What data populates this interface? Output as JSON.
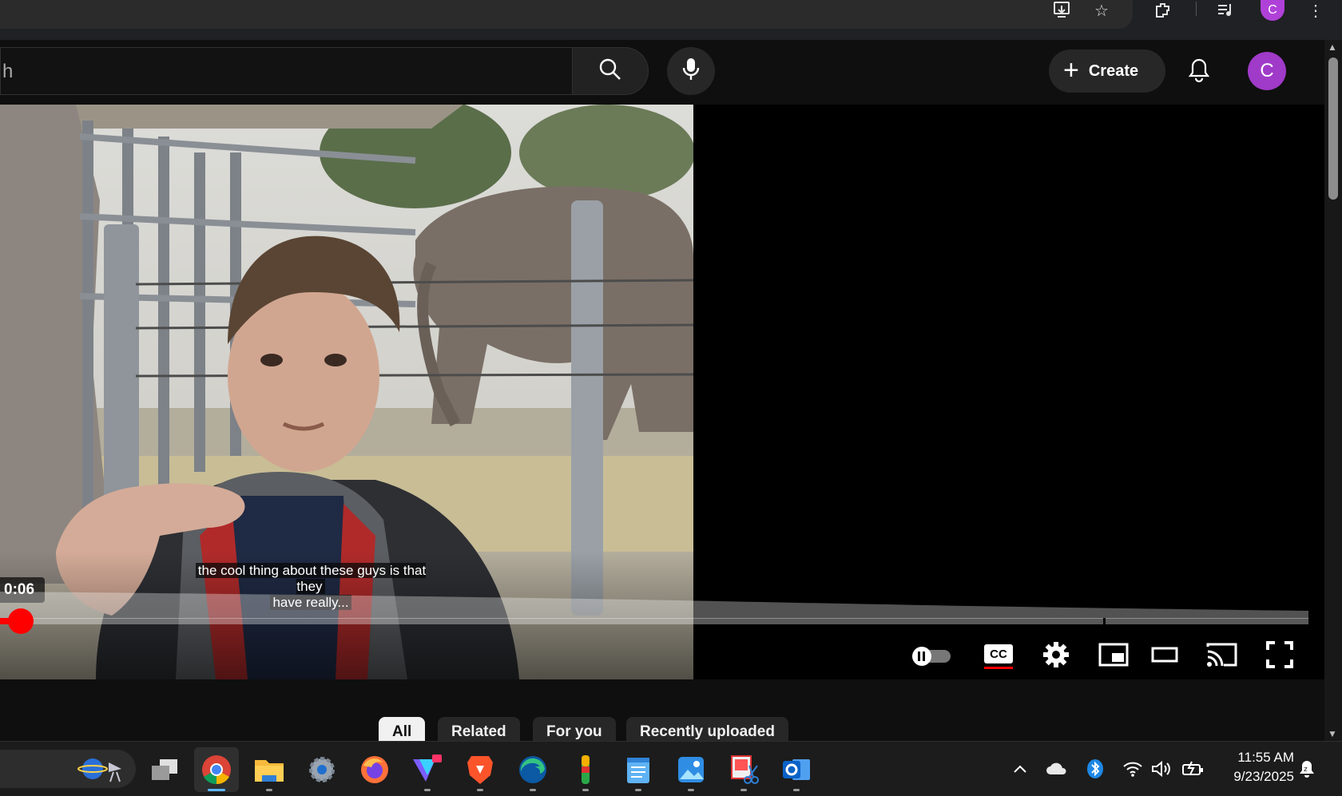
{
  "chrome": {
    "profile_initial": "C",
    "icons": [
      "install-app-icon",
      "bookmark-star-icon",
      "extensions-icon",
      "media-controls-icon",
      "profile-avatar",
      "menu-icon"
    ]
  },
  "header": {
    "search_text": "h",
    "create_label": "Create",
    "avatar_initial": "C",
    "icons": [
      "search-icon",
      "microphone-icon",
      "plus-icon",
      "bell-icon"
    ]
  },
  "player": {
    "caption_line1": "the cool thing about these guys is that they",
    "caption_line2": "have really...",
    "hover_time": "0:06",
    "progress_fraction": 0.016,
    "controls": [
      "autoplay-toggle",
      "captions-icon",
      "settings-gear-icon",
      "miniplayer-icon",
      "theater-mode-icon",
      "cast-icon",
      "fullscreen-icon"
    ],
    "cc_label": "CC"
  },
  "chips": [
    {
      "label": "All",
      "active": true
    },
    {
      "label": "Related",
      "active": false
    },
    {
      "label": "For you",
      "active": false
    },
    {
      "label": "Recently uploaded",
      "active": false
    }
  ],
  "taskbar": {
    "apps": [
      "search-box",
      "task-view-icon",
      "chrome-icon",
      "file-explorer-icon",
      "settings-icon",
      "firefox-icon",
      "vpn-icon",
      "brave-icon",
      "edge-icon",
      "onepassword-icon",
      "notepad-icon",
      "photos-icon",
      "snipping-tool-icon",
      "outlook-icon"
    ],
    "tray": [
      "chevron-up-icon",
      "onedrive-icon",
      "bluetooth-icon",
      "wifi-icon",
      "volume-icon",
      "battery-icon",
      "notifications-icon"
    ],
    "time": "11:55 AM",
    "date": "9/23/2025"
  },
  "colors": {
    "accent_red": "#ff0000",
    "avatar_purple": "#a03ac9",
    "background": "#0f0f0f"
  }
}
